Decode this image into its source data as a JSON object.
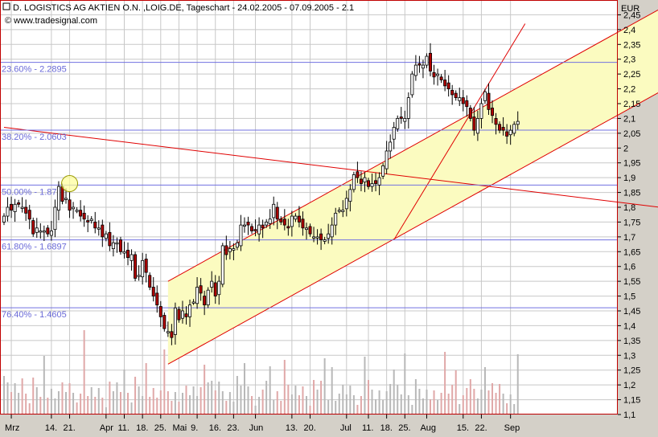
{
  "header": {
    "title": "D. LOGISTICS AG AKTIEN O.N. ,LOIG.DE, Tageschart - 24.02.2005 - 07.09.2005 - 2.1",
    "source": "© www.tradesignal.com"
  },
  "colors": {
    "plot_bg": "#ffffff",
    "frame": "#c00000",
    "grid": "#c8c8c8",
    "fib_line": "#7070e0",
    "fib_text": "#6a6ad8",
    "channel_fill": "#fbfbc0",
    "channel_line": "#e00000",
    "candle_up": "#ffffff",
    "candle_down": "#b00000",
    "volume": "#b8b8b8",
    "marker_fill": "#ffff99"
  },
  "chart_data": {
    "type": "candlestick",
    "title": "D. LOGISTICS AG AKTIEN O.N. ,LOIG.DE, Tageschart - 24.02.2005 - 07.09.2005 - 2.1",
    "y_unit": "EUR",
    "ylim": [
      1.1,
      2.5
    ],
    "y_ticks": [
      "2,45",
      "2,4",
      "2,35",
      "2,3",
      "2,25",
      "2,2",
      "2,15",
      "2,1",
      "2,05",
      "2",
      "1,95",
      "1,9",
      "1,85",
      "1,8",
      "1,75",
      "1,7",
      "1,65",
      "1,6",
      "1,55",
      "1,5",
      "1,45",
      "1,4",
      "1,35",
      "1,3",
      "1,25",
      "1,2",
      "1,15",
      "1,1"
    ],
    "y_tick_values": [
      2.45,
      2.4,
      2.35,
      2.3,
      2.25,
      2.2,
      2.15,
      2.1,
      2.05,
      2.0,
      1.95,
      1.9,
      1.85,
      1.8,
      1.75,
      1.7,
      1.65,
      1.6,
      1.55,
      1.5,
      1.45,
      1.4,
      1.35,
      1.3,
      1.25,
      1.2,
      1.15,
      1.1
    ],
    "x_ticks": [
      {
        "label": "Mrz",
        "bar": 2
      },
      {
        "label": "14.",
        "bar": 13
      },
      {
        "label": "21.",
        "bar": 18
      },
      {
        "label": "Apr",
        "bar": 28
      },
      {
        "label": "11.",
        "bar": 33
      },
      {
        "label": "18.",
        "bar": 38
      },
      {
        "label": "25.",
        "bar": 43
      },
      {
        "label": "Mai",
        "bar": 48
      },
      {
        "label": "9.",
        "bar": 53
      },
      {
        "label": "16.",
        "bar": 58
      },
      {
        "label": "23.",
        "bar": 63
      },
      {
        "label": "Jun",
        "bar": 69
      },
      {
        "label": "13.",
        "bar": 79
      },
      {
        "label": "20.",
        "bar": 84
      },
      {
        "label": "Jul",
        "bar": 94
      },
      {
        "label": "11.",
        "bar": 100
      },
      {
        "label": "18.",
        "bar": 105
      },
      {
        "label": "25.",
        "bar": 110
      },
      {
        "label": "Aug",
        "bar": 116
      },
      {
        "label": "15.",
        "bar": 126
      },
      {
        "label": "22.",
        "bar": 131
      },
      {
        "label": "Sep",
        "bar": 139
      }
    ],
    "fibonacci": [
      {
        "label": "23.60% - 2.2895",
        "value": 2.2895
      },
      {
        "label": "38.20% - 2.0603",
        "value": 2.0603
      },
      {
        "label": "50.00% - 1.87",
        "value": 1.875
      },
      {
        "label": "61.80% - 1.6897",
        "value": 1.6897
      },
      {
        "label": "76.40% - 1.4605",
        "value": 1.4605
      }
    ],
    "close": [
      1.77,
      1.8,
      1.79,
      1.81,
      1.81,
      1.8,
      1.78,
      1.76,
      1.71,
      1.73,
      1.72,
      1.72,
      1.71,
      1.72,
      1.8,
      1.87,
      1.82,
      1.83,
      1.79,
      1.8,
      1.79,
      1.77,
      1.76,
      1.75,
      1.76,
      1.73,
      1.73,
      1.7,
      1.71,
      1.67,
      1.68,
      1.68,
      1.65,
      1.65,
      1.63,
      1.64,
      1.56,
      1.57,
      1.62,
      1.58,
      1.53,
      1.5,
      1.47,
      1.43,
      1.39,
      1.38,
      1.36,
      1.46,
      1.42,
      1.45,
      1.43,
      1.47,
      1.48,
      1.53,
      1.51,
      1.47,
      1.52,
      1.55,
      1.5,
      1.55,
      1.67,
      1.64,
      1.66,
      1.66,
      1.68,
      1.74,
      1.74,
      1.74,
      1.72,
      1.72,
      1.74,
      1.73,
      1.75,
      1.76,
      1.81,
      1.76,
      1.75,
      1.74,
      1.73,
      1.77,
      1.77,
      1.75,
      1.73,
      1.73,
      1.71,
      1.7,
      1.7,
      1.69,
      1.69,
      1.71,
      1.74,
      1.78,
      1.79,
      1.79,
      1.83,
      1.86,
      1.91,
      1.9,
      1.88,
      1.9,
      1.87,
      1.88,
      1.88,
      1.9,
      1.94,
      1.99,
      2.02,
      2.07,
      2.1,
      2.1,
      2.1,
      2.17,
      2.25,
      2.28,
      2.28,
      2.28,
      2.31,
      2.26,
      2.24,
      2.25,
      2.23,
      2.21,
      2.2,
      2.18,
      2.17,
      2.17,
      2.15,
      2.14,
      2.1,
      2.06,
      2.1,
      2.15,
      2.19,
      2.13,
      2.11,
      2.08,
      2.06,
      2.06,
      2.04,
      2.06,
      2.08,
      2.09
    ],
    "ranges_note": "close values read from chart; open/high/low derived around them",
    "trendlines": [
      {
        "name": "channel-lower",
        "from": {
          "bar": 45,
          "value": 1.27
        },
        "to": {
          "bar": 180,
          "value": 2.19
        }
      },
      {
        "name": "channel-upper",
        "from": {
          "bar": 45,
          "value": 1.55
        },
        "to": {
          "bar": 180,
          "value": 2.47
        }
      },
      {
        "name": "downtrend",
        "from": {
          "bar": 0,
          "value": 2.07
        },
        "to": {
          "bar": 180,
          "value": 1.8
        }
      },
      {
        "name": "steep-uptrend",
        "from": {
          "bar": 107,
          "value": 1.69
        },
        "to": {
          "bar": 143,
          "value": 2.42
        }
      }
    ],
    "marker": {
      "bar": 18,
      "value": 1.88
    }
  }
}
